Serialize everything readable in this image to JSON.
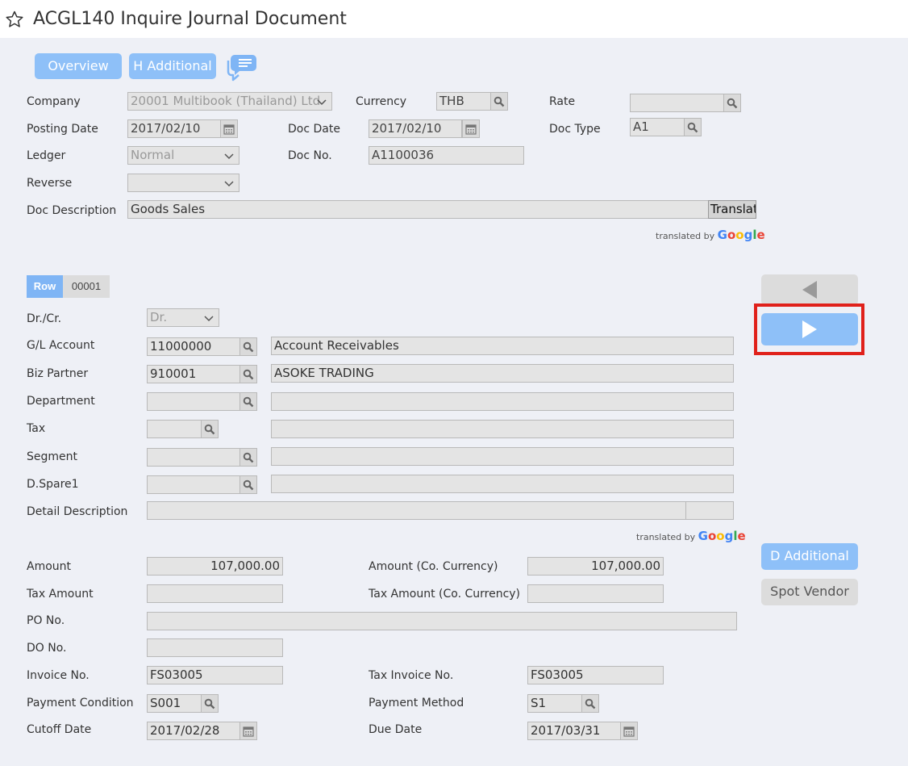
{
  "header": {
    "title": "ACGL140 Inquire Journal Document"
  },
  "toolbar": {
    "overview": "Overview",
    "h_additional": "H Additional"
  },
  "doc": {
    "company_label": "Company",
    "company_value": "20001 Multibook (Thailand) Ltd",
    "currency_label": "Currency",
    "currency_value": "THB",
    "rate_label": "Rate",
    "rate_value": "",
    "posting_date_label": "Posting Date",
    "posting_date_value": "2017/02/10",
    "doc_date_label": "Doc Date",
    "doc_date_value": "2017/02/10",
    "doc_type_label": "Doc Type",
    "doc_type_value": "A1",
    "ledger_label": "Ledger",
    "ledger_value": "Normal",
    "doc_no_label": "Doc No.",
    "doc_no_value": "A1100036",
    "reverse_label": "Reverse",
    "reverse_value": "",
    "desc_label": "Doc Description",
    "desc_value": "Goods Sales",
    "translate_label": "Translat",
    "translated_by": "translated by",
    "google": "Google"
  },
  "detail": {
    "row_label": "Row",
    "row_number": "00001",
    "drcr_label": "Dr./Cr.",
    "drcr_value": "Dr.",
    "gl_label": "G/L Account",
    "gl_code": "11000000",
    "gl_name": "Account Receivables",
    "bp_label": "Biz Partner",
    "bp_code": "910001",
    "bp_name": "ASOKE TRADING",
    "dept_label": "Department",
    "tax_label": "Tax",
    "segment_label": "Segment",
    "spare_label": "D.Spare1",
    "detail_desc_label": "Detail Description",
    "translated_by": "translated by",
    "google": "Google"
  },
  "amounts": {
    "amount_label": "Amount",
    "amount_value": "107,000.00",
    "amount_co_label": "Amount (Co. Currency)",
    "amount_co_value": "107,000.00",
    "tax_amount_label": "Tax Amount",
    "tax_amount_co_label": "Tax Amount (Co. Currency)",
    "po_label": "PO No.",
    "do_label": "DO No.",
    "invoice_label": "Invoice No.",
    "invoice_value": "FS03005",
    "tax_invoice_label": "Tax Invoice No.",
    "tax_invoice_value": "FS03005",
    "pay_cond_label": "Payment Condition",
    "pay_cond_value": "S001",
    "pay_method_label": "Payment Method",
    "pay_method_value": "S1",
    "cutoff_label": "Cutoff Date",
    "cutoff_value": "2017/02/28",
    "due_label": "Due Date",
    "due_value": "2017/03/31"
  },
  "side": {
    "d_additional": "D Additional",
    "spot_vendor": "Spot Vendor"
  },
  "colors": {
    "accent": "#8ec0f8",
    "highlight": "#e0211b",
    "field_bg": "#e4e4e4",
    "page_bg": "#eef0f6"
  }
}
